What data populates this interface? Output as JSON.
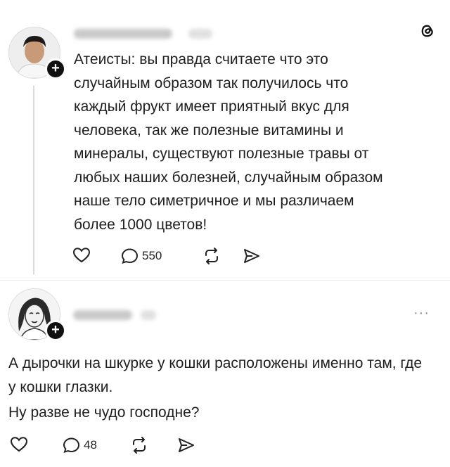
{
  "post": {
    "text": "Атеисты: вы правда считаете что это случайным образом так получилось что каждый фрукт имеет приятный вкус для человека, так же полезные витамины и минералы, существуют полезные травы от любых наших болезней, случайным образом наше тело симетричное и мы различаем более 1000 цветов!",
    "comment_count": "550",
    "follow_glyph": "+"
  },
  "reply": {
    "text_line1": "А дырочки на шкурке у кошки расположены именно там, где у кошки глазки.",
    "text_line2": "Ну разве не чудо господне?",
    "comment_count": "48",
    "follow_glyph": "+",
    "more_glyph": "···"
  },
  "icons": [
    "threads-logo-icon",
    "heart-icon",
    "comment-icon",
    "repost-icon",
    "share-icon",
    "more-icon"
  ]
}
